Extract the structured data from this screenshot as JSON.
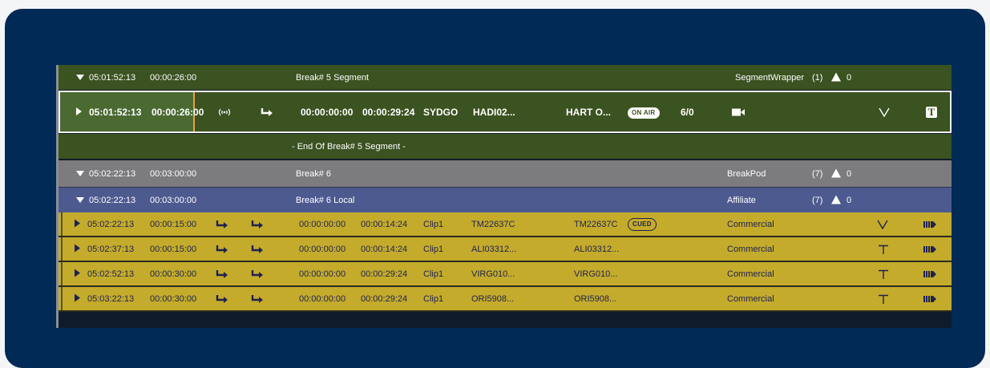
{
  "segment": {
    "time": "05:01:52:13",
    "duration": "00:00:26:00",
    "title": "Break# 5 Segment",
    "type": "SegmentWrapper",
    "count": "(1)",
    "alerts": "0"
  },
  "on_air_item": {
    "time": "05:01:52:13",
    "duration": "00:00:26:00",
    "som": "00:00:00:00",
    "eom": "00:00:29:24",
    "device": "SYDGO",
    "house_id": "HADI02...",
    "title": "HART O...",
    "status": "ON AIR",
    "ratio": "6/0",
    "icons": [
      "play-icon",
      "broadcast-icon",
      "hard-start-arrow-icon",
      "camera-icon",
      "checkmark-icon",
      "text-overlay-icon"
    ]
  },
  "end_segment": {
    "label": "- End Of Break# 5 Segment -"
  },
  "break_pod": {
    "time": "05:02:22:13",
    "duration": "00:03:00:00",
    "title": "Break# 6",
    "type": "BreakPod",
    "count": "(7)",
    "alerts": "0"
  },
  "affiliate": {
    "time": "05:02:22:13",
    "duration": "00:03:00:00",
    "title": "Break# 6 Local",
    "type": "Affiliate",
    "count": "(7)",
    "alerts": "0"
  },
  "clips": [
    {
      "time": "05:02:22:13",
      "duration": "00:00:15:00",
      "som": "00:00:00:00",
      "eom": "00:00:14:24",
      "device": "Clip1",
      "house_id": "TM22637C",
      "title": "TM22637C",
      "status": "CUED",
      "type": "Commercial",
      "mark": "V"
    },
    {
      "time": "05:02:37:13",
      "duration": "00:00:15:00",
      "som": "00:00:00:00",
      "eom": "00:00:14:24",
      "device": "Clip1",
      "house_id": "ALI03312...",
      "title": "ALI03312...",
      "status": "",
      "type": "Commercial",
      "mark": "T"
    },
    {
      "time": "05:02:52:13",
      "duration": "00:00:30:00",
      "som": "00:00:00:00",
      "eom": "00:00:29:24",
      "device": "Clip1",
      "house_id": "VIRG010...",
      "title": "VIRG010...",
      "status": "",
      "type": "Commercial",
      "mark": "T"
    },
    {
      "time": "05:03:22:13",
      "duration": "00:00:30:00",
      "som": "00:00:00:00",
      "eom": "00:00:29:24",
      "device": "Clip1",
      "house_id": "ORI5908...",
      "title": "ORI5908...",
      "status": "",
      "type": "Commercial",
      "mark": "T"
    }
  ],
  "colors": {
    "frame": "#012a56",
    "segment_green": "#3b5221",
    "break_pod_gray": "#7c7b7e",
    "affiliate_blue": "#4d5a8f",
    "commercial_yellow": "#c4ab2b",
    "progress_marker": "#f0a03a"
  }
}
